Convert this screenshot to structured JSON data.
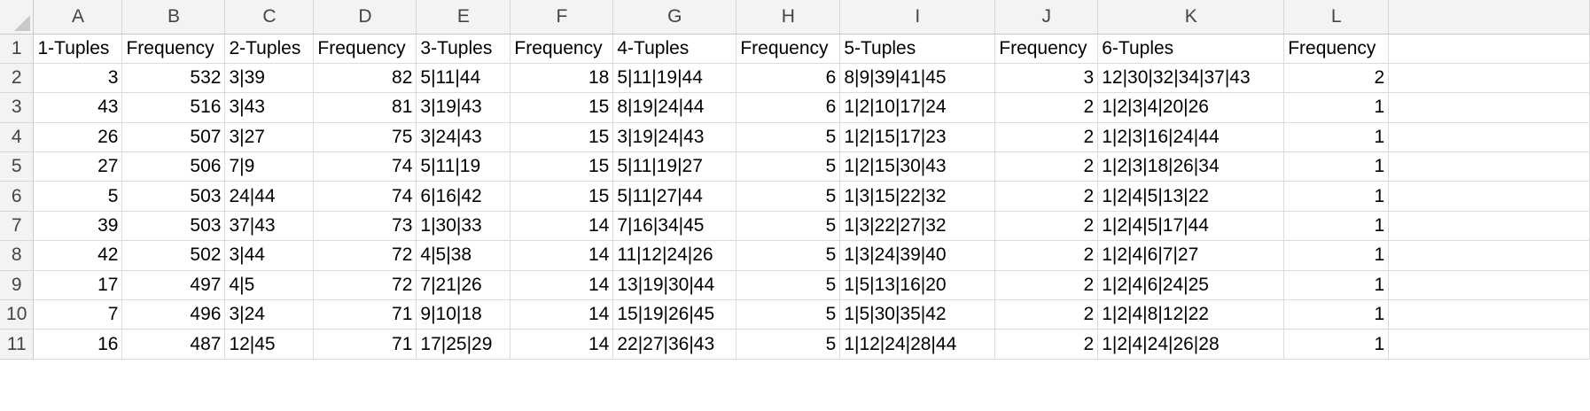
{
  "sheet": {
    "columns": [
      "A",
      "B",
      "C",
      "D",
      "E",
      "F",
      "G",
      "H",
      "I",
      "J",
      "K",
      "L"
    ],
    "rows": [
      {
        "num": "1",
        "cells": [
          "1-Tuples",
          "Frequency",
          "2-Tuples",
          "Frequency",
          "3-Tuples",
          "Frequency",
          "4-Tuples",
          "Frequency",
          "5-Tuples",
          "Frequency",
          "6-Tuples",
          "Frequency"
        ]
      },
      {
        "num": "2",
        "cells": [
          "3",
          "532",
          "3|39",
          "82",
          "5|11|44",
          "18",
          "5|11|19|44",
          "6",
          "8|9|39|41|45",
          "3",
          "12|30|32|34|37|43",
          "2"
        ]
      },
      {
        "num": "3",
        "cells": [
          "43",
          "516",
          "3|43",
          "81",
          "3|19|43",
          "15",
          "8|19|24|44",
          "6",
          "1|2|10|17|24",
          "2",
          "1|2|3|4|20|26",
          "1"
        ]
      },
      {
        "num": "4",
        "cells": [
          "26",
          "507",
          "3|27",
          "75",
          "3|24|43",
          "15",
          "3|19|24|43",
          "5",
          "1|2|15|17|23",
          "2",
          "1|2|3|16|24|44",
          "1"
        ]
      },
      {
        "num": "5",
        "cells": [
          "27",
          "506",
          "7|9",
          "74",
          "5|11|19",
          "15",
          "5|11|19|27",
          "5",
          "1|2|15|30|43",
          "2",
          "1|2|3|18|26|34",
          "1"
        ]
      },
      {
        "num": "6",
        "cells": [
          "5",
          "503",
          "24|44",
          "74",
          "6|16|42",
          "15",
          "5|11|27|44",
          "5",
          "1|3|15|22|32",
          "2",
          "1|2|4|5|13|22",
          "1"
        ]
      },
      {
        "num": "7",
        "cells": [
          "39",
          "503",
          "37|43",
          "73",
          "1|30|33",
          "14",
          "7|16|34|45",
          "5",
          "1|3|22|27|32",
          "2",
          "1|2|4|5|17|44",
          "1"
        ]
      },
      {
        "num": "8",
        "cells": [
          "42",
          "502",
          "3|44",
          "72",
          "4|5|38",
          "14",
          "11|12|24|26",
          "5",
          "1|3|24|39|40",
          "2",
          "1|2|4|6|7|27",
          "1"
        ]
      },
      {
        "num": "9",
        "cells": [
          "17",
          "497",
          "4|5",
          "72",
          "7|21|26",
          "14",
          "13|19|30|44",
          "5",
          "1|5|13|16|20",
          "2",
          "1|2|4|6|24|25",
          "1"
        ]
      },
      {
        "num": "10",
        "cells": [
          "7",
          "496",
          "3|24",
          "71",
          "9|10|18",
          "14",
          "15|19|26|45",
          "5",
          "1|5|30|35|42",
          "2",
          "1|2|4|8|12|22",
          "1"
        ]
      },
      {
        "num": "11",
        "cells": [
          "16",
          "487",
          "12|45",
          "71",
          "17|25|29",
          "14",
          "22|27|36|43",
          "5",
          "1|12|24|28|44",
          "2",
          "1|2|4|24|26|28",
          "1"
        ]
      }
    ]
  }
}
